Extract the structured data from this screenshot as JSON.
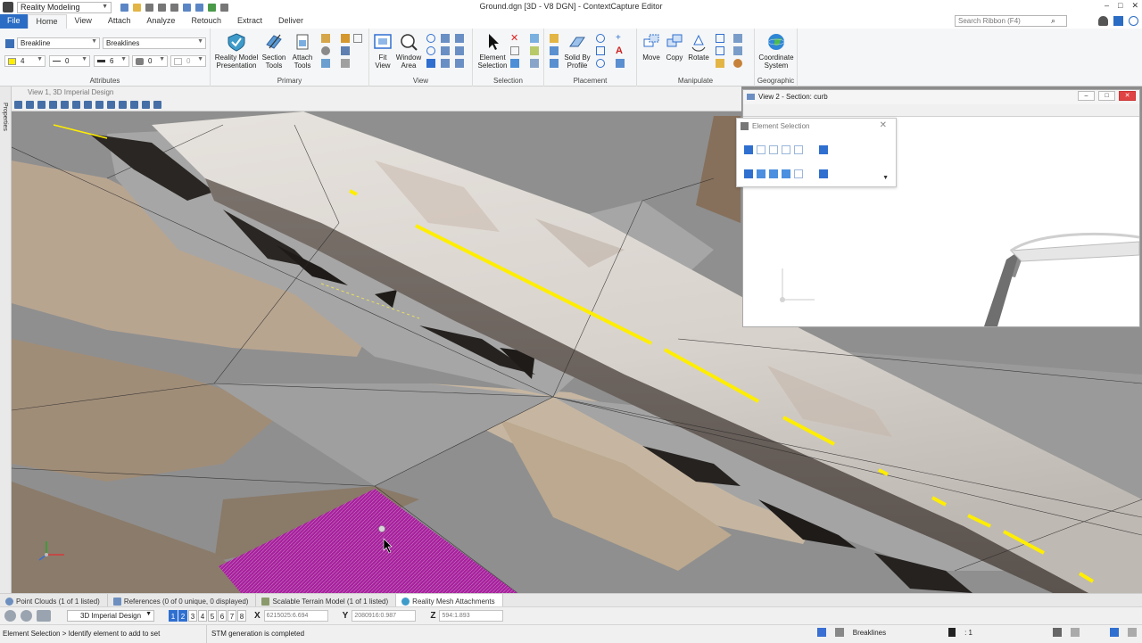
{
  "title_bar": {
    "workflow": "Reality Modeling",
    "window_title": "Ground.dgn [3D - V8 DGN] - ContextCapture Editor",
    "window_buttons": [
      "–",
      "□",
      "✕"
    ]
  },
  "tabs": [
    "File",
    "Home",
    "View",
    "Attach",
    "Analyze",
    "Retouch",
    "Extract",
    "Deliver"
  ],
  "search_placeholder": "Search Ribbon (F4)",
  "attributes": {
    "element_template": "Breakline",
    "level": "Breaklines",
    "color": "4",
    "line_style": "0",
    "weight": "6",
    "transparency": "0",
    "priority": "0",
    "label": "Attributes"
  },
  "primary": {
    "reality_model_presentation": "Reality Model Presentation",
    "section_tools": "Section Tools",
    "attach_tools": "Attach Tools",
    "label": "Primary"
  },
  "view_group": {
    "fit_view": "Fit View",
    "window_area": "Window Area",
    "label": "View"
  },
  "selection_group": {
    "element_selection": "Element Selection",
    "label": "Selection"
  },
  "placement_group": {
    "solid_by_profile": "Solid By Profile",
    "label": "Placement"
  },
  "manipulate_group": {
    "move": "Move",
    "copy": "Copy",
    "rotate": "Rotate",
    "label": "Manipulate"
  },
  "geographic_group": {
    "coordinate_system": "Coordinate System",
    "label": "Geographic"
  },
  "properties_label": "Properties",
  "view1": {
    "title": "View 1, 3D Imperial Design"
  },
  "view2": {
    "title": "View 2 - Section: curb"
  },
  "element_selection_dialog": {
    "title": "Element Selection"
  },
  "attach_tabs": [
    "Point Clouds (1 of 1 listed)",
    "References (0 of 0 unique, 0 displayed)",
    "Scalable Terrain Model (1 of 1 listed)",
    "Reality Mesh Attachments"
  ],
  "coord_bar": {
    "model": "3D Imperial Design",
    "view_numbers": [
      "1",
      "2",
      "3",
      "4",
      "5",
      "6",
      "7",
      "8"
    ],
    "x_label": "X",
    "x_value": "6215025:6.694",
    "y_label": "Y",
    "y_value": "2080916:0.987",
    "z_label": "Z",
    "z_value": "594:1.893"
  },
  "status": {
    "prompt": "Element Selection > Identify element to add to set",
    "message": "STM generation is completed",
    "active_level": "Breaklines",
    "selection_count": ": 1"
  },
  "colors": {
    "file_tab": "#2b6cc4",
    "breakline_yellow": "#ffee00",
    "selection_magenta": "#a8209e"
  }
}
